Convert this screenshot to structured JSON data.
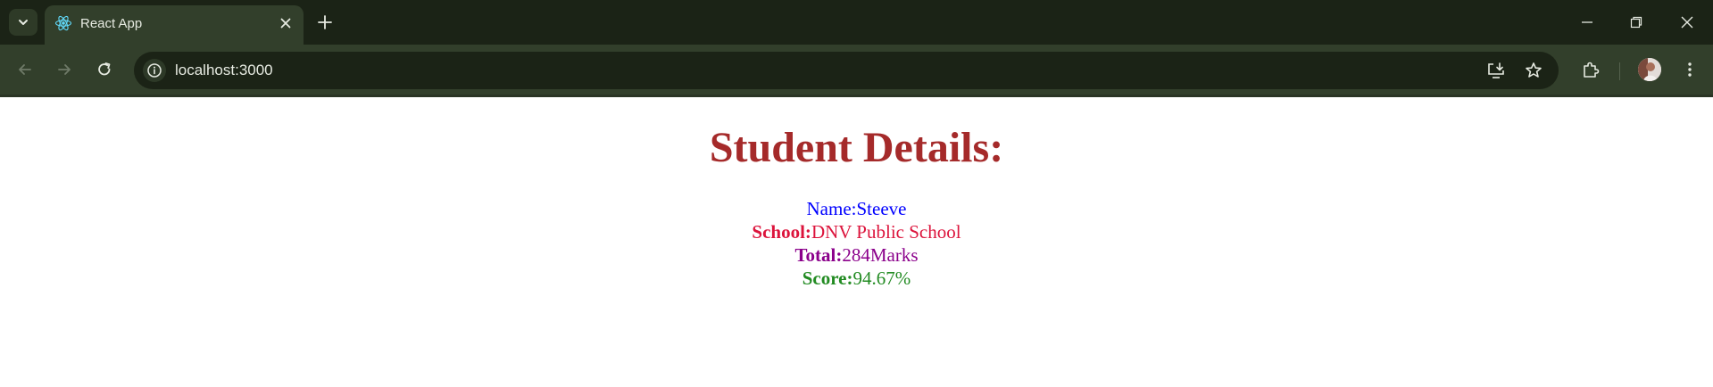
{
  "browser": {
    "tab": {
      "title": "React App",
      "favicon": "react-logo-icon"
    },
    "url": "localhost:3000",
    "icons": {
      "tab_search": "chevron-down-icon",
      "tab_close": "close-icon",
      "new_tab": "plus-icon",
      "minimize": "minimize-icon",
      "restore": "restore-icon",
      "close_window": "close-icon",
      "back": "arrow-left-icon",
      "forward": "arrow-right-icon",
      "reload": "reload-icon",
      "site_info": "info-icon",
      "install": "install-app-icon",
      "bookmark": "star-icon",
      "extensions": "puzzle-icon",
      "profile": "avatar",
      "menu": "kebab-menu-icon"
    },
    "colors": {
      "tabstrip": "#1b2316",
      "toolbar": "#323f2b",
      "text": "#e6eae1"
    }
  },
  "page": {
    "title": "Student Details:",
    "details": {
      "name_label": "Name:",
      "name_value": "Steeve",
      "school_label": "School:",
      "school_value": "DNV Public School",
      "total_label": "Total:",
      "total_value": "284Marks",
      "score_label": "Score:",
      "score_value": "94.67%"
    },
    "colors": {
      "title": "#a52a2a",
      "name": "#0000ff",
      "school": "#dc143c",
      "total": "#8b008b",
      "score": "#228b22"
    }
  }
}
